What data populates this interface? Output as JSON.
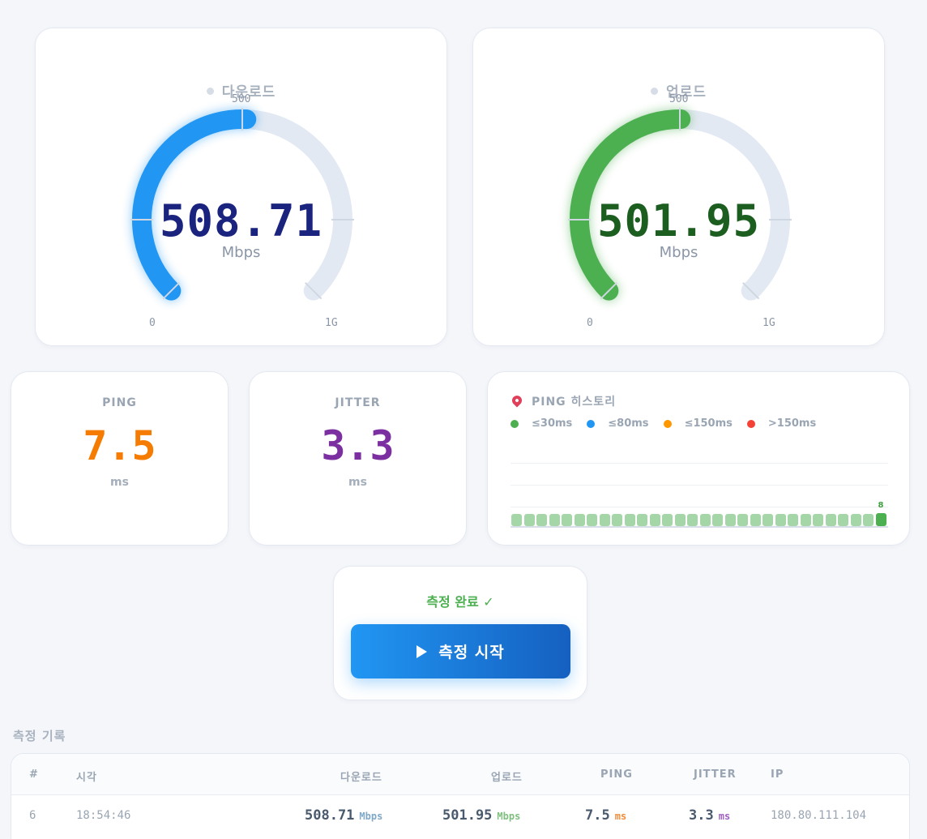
{
  "download": {
    "title": "다운로드",
    "value": "508.71",
    "unit": "Mbps",
    "tick_min": "0",
    "tick_mid": "500",
    "tick_max": "1G",
    "level": 0.509,
    "color": "#2196f3",
    "value_color": "#1a237e"
  },
  "upload": {
    "title": "업로드",
    "value": "501.95",
    "unit": "Mbps",
    "tick_min": "0",
    "tick_mid": "500",
    "tick_max": "1G",
    "level": 0.502,
    "color": "#4caf50",
    "value_color": "#1b5e20"
  },
  "ping": {
    "label": "PING",
    "value": "7.5",
    "unit": "ms",
    "color": "#f57c00"
  },
  "jitter": {
    "label": "JITTER",
    "value": "3.3",
    "unit": "ms",
    "color": "#7b2fa0"
  },
  "history": {
    "title": "PING 히스토리",
    "legend": [
      {
        "label": "≤30ms",
        "color": "#4caf50"
      },
      {
        "label": "≤80ms",
        "color": "#2196f3"
      },
      {
        "label": "≤150ms",
        "color": "#ff9800"
      },
      {
        "label": ">150ms",
        "color": "#f44336"
      }
    ],
    "bar_count": 30,
    "latest_label": "8",
    "bar_color": "#a5d6a7",
    "latest_color": "#4caf50"
  },
  "control": {
    "status": "측정 완료 ✓",
    "start_label": "측정 시작"
  },
  "records": {
    "title": "측정 기록",
    "headers": {
      "index": "#",
      "time": "시각",
      "download": "다운로드",
      "upload": "업로드",
      "ping": "PING",
      "jitter": "JITTER",
      "ip": "IP"
    },
    "rows": [
      {
        "index": "6",
        "time": "18:54:46",
        "download": "508.71",
        "download_unit": "Mbps",
        "upload": "501.95",
        "upload_unit": "Mbps",
        "ping": "7.5",
        "ping_unit": "ms",
        "jitter": "3.3",
        "jitter_unit": "ms",
        "ip": "180.80.111.104"
      }
    ]
  }
}
